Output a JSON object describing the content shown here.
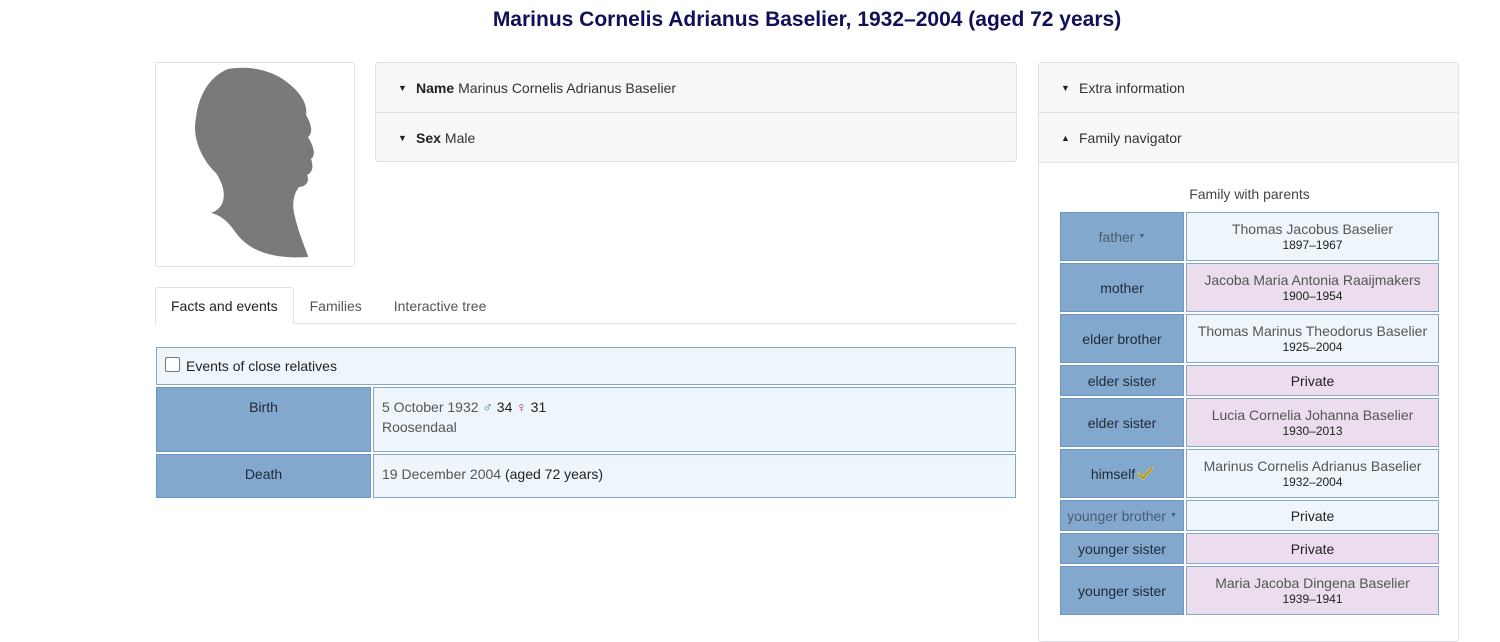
{
  "page": {
    "title": "Marinus Cornelis Adrianus Baselier, 1932–2004 (aged 72 years)"
  },
  "summary": {
    "name_label": "Name",
    "name_value": "Marinus Cornelis Adrianus Baselier",
    "sex_label": "Sex",
    "sex_value": "Male"
  },
  "tabs": {
    "facts": "Facts and events",
    "families": "Families",
    "tree": "Interactive tree"
  },
  "facts": {
    "close_relatives_label": "Events of close relatives",
    "birth": {
      "label": "Birth",
      "date": "5 October 1932",
      "father_age": "34",
      "mother_age": "31",
      "place": "Roosendaal"
    },
    "death": {
      "label": "Death",
      "date": "19 December 2004",
      "age": "(aged 72 years)"
    }
  },
  "sidebar": {
    "extra_info": "Extra information",
    "family_navigator": "Family navigator",
    "family_title": "Family with parents",
    "members": [
      {
        "role": "father",
        "name": "Thomas Jacobus Baselier",
        "dates": "1897–1967"
      },
      {
        "role": "mother",
        "name": "Jacoba Maria Antonia Raaijmakers",
        "dates": "1900–1954"
      },
      {
        "role": "elder brother",
        "name": "Thomas Marinus Theodorus Baselier",
        "dates": "1925–2004"
      },
      {
        "role": "elder sister",
        "name": "Private",
        "dates": ""
      },
      {
        "role": "elder sister",
        "name": "Lucia Cornelia Johanna Baselier",
        "dates": "1930–2013"
      },
      {
        "role": "himself",
        "name": "Marinus Cornelis Adrianus Baselier",
        "dates": "1932–2004"
      },
      {
        "role": "younger brother",
        "name": "Private",
        "dates": ""
      },
      {
        "role": "younger sister",
        "name": "Private",
        "dates": ""
      },
      {
        "role": "younger sister",
        "name": "Maria Jacoba Dingena Baselier",
        "dates": "1939–1941"
      }
    ]
  },
  "colors": {
    "title": "#101058",
    "label_bg": "#83a8ce",
    "male_bg": "#eef6fc",
    "female_bg": "#ebdcee"
  },
  "icons": {
    "male_symbol": "♂",
    "female_symbol": "♀",
    "caret_down": "▼",
    "caret_up": "▲",
    "dropdown": "▼"
  }
}
